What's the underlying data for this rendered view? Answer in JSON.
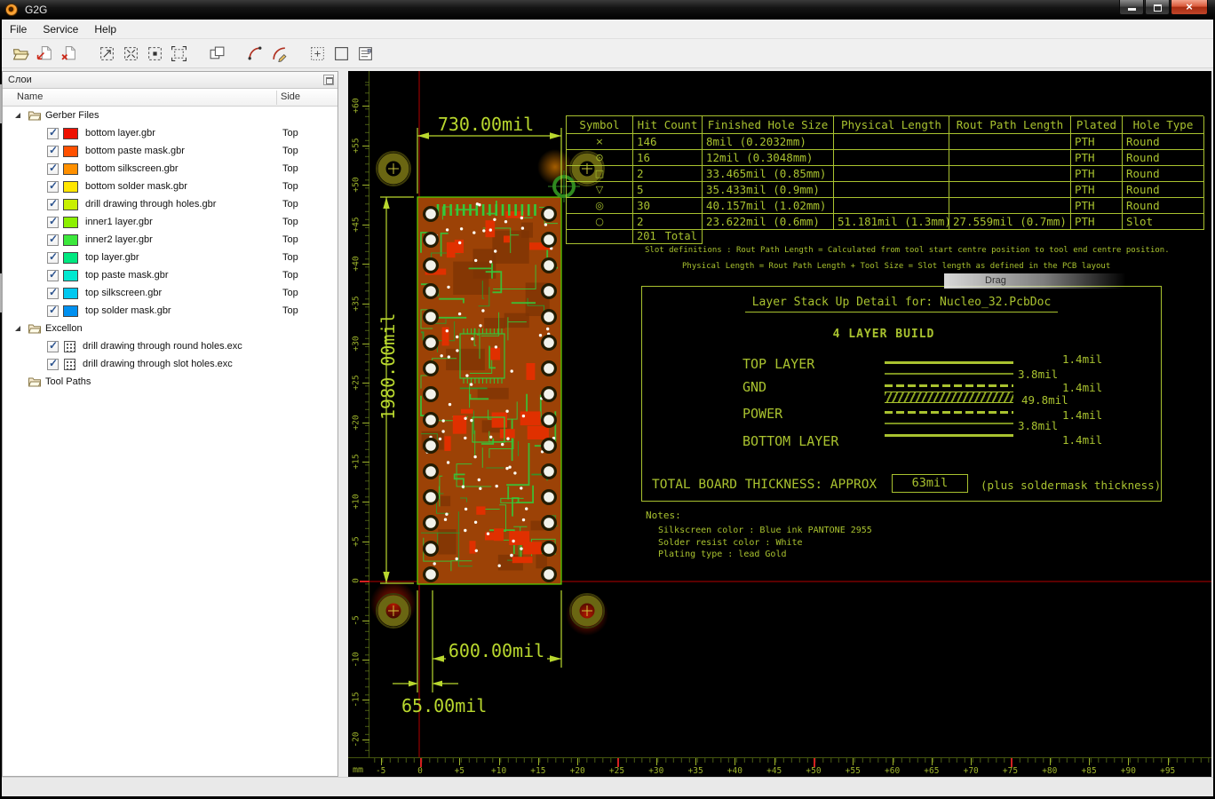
{
  "window": {
    "title": "G2G"
  },
  "menu": {
    "items": [
      "File",
      "Service",
      "Help"
    ]
  },
  "toolbar": {
    "buttons": [
      {
        "name": "open-file",
        "icon": "folder"
      },
      {
        "name": "import-gerber",
        "icon": "page-arrow"
      },
      {
        "name": "close-gerber",
        "icon": "page-x"
      },
      {
        "name": "zoom-window",
        "icon": "zoom-window",
        "gap": true
      },
      {
        "name": "zoom-fit",
        "icon": "zoom-fit"
      },
      {
        "name": "zoom-selection",
        "icon": "zoom-selection"
      },
      {
        "name": "zoom-extents",
        "icon": "zoom-extents"
      },
      {
        "name": "tile-view",
        "icon": "tile",
        "gap": true
      },
      {
        "name": "arc-tool",
        "icon": "arc",
        "gap": true
      },
      {
        "name": "arc-edit",
        "icon": "arc-edit"
      },
      {
        "name": "grid-toggle",
        "icon": "grid",
        "gap": true
      },
      {
        "name": "frame-toggle",
        "icon": "frame"
      },
      {
        "name": "report",
        "icon": "report"
      }
    ]
  },
  "layers_panel": {
    "title": "Слои",
    "columns": {
      "name": "Name",
      "side": "Side"
    },
    "tree": [
      {
        "type": "group",
        "label": "Gerber Files",
        "expanded": true
      },
      {
        "type": "layer",
        "label": "bottom layer.gbr",
        "side": "Top",
        "color": "#ee1000",
        "checked": true
      },
      {
        "type": "layer",
        "label": "bottom paste mask.gbr",
        "side": "Top",
        "color": "#ff5000",
        "checked": true
      },
      {
        "type": "layer",
        "label": "bottom silkscreen.gbr",
        "side": "Top",
        "color": "#ff9000",
        "checked": true
      },
      {
        "type": "layer",
        "label": "bottom solder mask.gbr",
        "side": "Top",
        "color": "#ffe600",
        "checked": true
      },
      {
        "type": "layer",
        "label": "drill drawing through holes.gbr",
        "side": "Top",
        "color": "#c8f000",
        "checked": true
      },
      {
        "type": "layer",
        "label": "inner1 layer.gbr",
        "side": "Top",
        "color": "#8cf000",
        "checked": true
      },
      {
        "type": "layer",
        "label": "inner2 layer.gbr",
        "side": "Top",
        "color": "#3ce83c",
        "checked": true
      },
      {
        "type": "layer",
        "label": "top layer.gbr",
        "side": "Top",
        "color": "#00e880",
        "checked": true
      },
      {
        "type": "layer",
        "label": "top paste mask.gbr",
        "side": "Top",
        "color": "#00e8d0",
        "checked": true
      },
      {
        "type": "layer",
        "label": "top silkscreen.gbr",
        "side": "Top",
        "color": "#00c8f0",
        "checked": true
      },
      {
        "type": "layer",
        "label": "top solder mask.gbr",
        "side": "Top",
        "color": "#0090f0",
        "checked": true
      },
      {
        "type": "group",
        "label": "Excellon",
        "expanded": true
      },
      {
        "type": "drill",
        "label": "drill drawing through round holes.exc",
        "checked": true
      },
      {
        "type": "drill",
        "label": "drill drawing through slot holes.exc",
        "checked": true
      },
      {
        "type": "group",
        "label": "Tool Paths",
        "expanded": false,
        "arrow": false
      }
    ]
  },
  "canvas": {
    "rulers": {
      "unit": "mm",
      "h_labels": [
        "-5",
        "0",
        "+5",
        "+10",
        "+15",
        "+20",
        "+25",
        "+30",
        "+35",
        "+40",
        "+45",
        "+50",
        "+55",
        "+60",
        "+65",
        "+70",
        "+75",
        "+80",
        "+85",
        "+90",
        "+95"
      ],
      "h_red": [
        "0",
        "+25",
        "+50",
        "+75"
      ],
      "v_labels": [
        "+60",
        "+55",
        "+50",
        "+45",
        "+40",
        "+35",
        "+30",
        "+25",
        "+20",
        "+15",
        "+10",
        "+5",
        "0",
        "-5",
        "-10",
        "-15",
        "-20"
      ],
      "v_red": [
        "0"
      ]
    },
    "dimensions": {
      "width": "730.00mil",
      "height": "1980.00mil",
      "bottom_width": "600.00mil",
      "offset": "65.00mil"
    },
    "drill_table": {
      "headers": [
        "Symbol",
        "Hit Count",
        "Finished Hole Size",
        "Physical Length",
        "Rout Path Length",
        "Plated",
        "Hole Type"
      ],
      "rows": [
        [
          "×",
          "146",
          "8mil (0.2032mm)",
          "",
          "",
          "PTH",
          "Round"
        ],
        [
          "⊙",
          "16",
          "12mil (0.3048mm)",
          "",
          "",
          "PTH",
          "Round"
        ],
        [
          "□",
          "2",
          "33.465mil (0.85mm)",
          "",
          "",
          "PTH",
          "Round"
        ],
        [
          "▽",
          "5",
          "35.433mil (0.9mm)",
          "",
          "",
          "PTH",
          "Round"
        ],
        [
          "◎",
          "30",
          "40.157mil (1.02mm)",
          "",
          "",
          "PTH",
          "Round"
        ],
        [
          "○",
          "2",
          "23.622mil (0.6mm)",
          "51.181mil (1.3mm)",
          "27.559mil (0.7mm)",
          "PTH",
          "Slot"
        ]
      ],
      "total_hits": "201",
      "total_label": "Total"
    },
    "slot_definitions": {
      "line1": "Slot definitions :  Rout Path Length  =  Calculated from tool start centre position to tool end centre position.",
      "line2": "Physical Length    =  Rout Path Length  +  Tool Size  =  Slot length as defined in the PCB layout"
    },
    "drag_hint": "Drag",
    "stackup": {
      "title": "Layer Stack Up Detail for: Nucleo_32.PcbDoc",
      "subtitle": "4 LAYER BUILD",
      "layers": [
        "TOP LAYER",
        "GND",
        "POWER",
        "BOTTOM LAYER"
      ],
      "thicknesses": [
        "1.4mil",
        "3.8mil",
        "1.4mil",
        "49.8mil",
        "1.4mil",
        "3.8mil",
        "1.4mil"
      ],
      "total_label": "TOTAL BOARD THICKNESS: APPROX",
      "total_value": "63mil",
      "total_suffix": "(plus soldermask thickness)"
    },
    "notes": {
      "title": "Notes:",
      "lines": [
        "Silkscreen color : Blue ink PANTONE 2955",
        "Solder resist color : White",
        "Plating type : lead Gold"
      ]
    }
  },
  "colors": {
    "annotation_green": "#a9c22f",
    "dimension_green": "#b9d82e",
    "crosshair_red": "#b40000",
    "copper": "#9c4206",
    "trace_green": "#35c93a",
    "pad_red": "#e03000",
    "board_outline": "#54d402"
  }
}
